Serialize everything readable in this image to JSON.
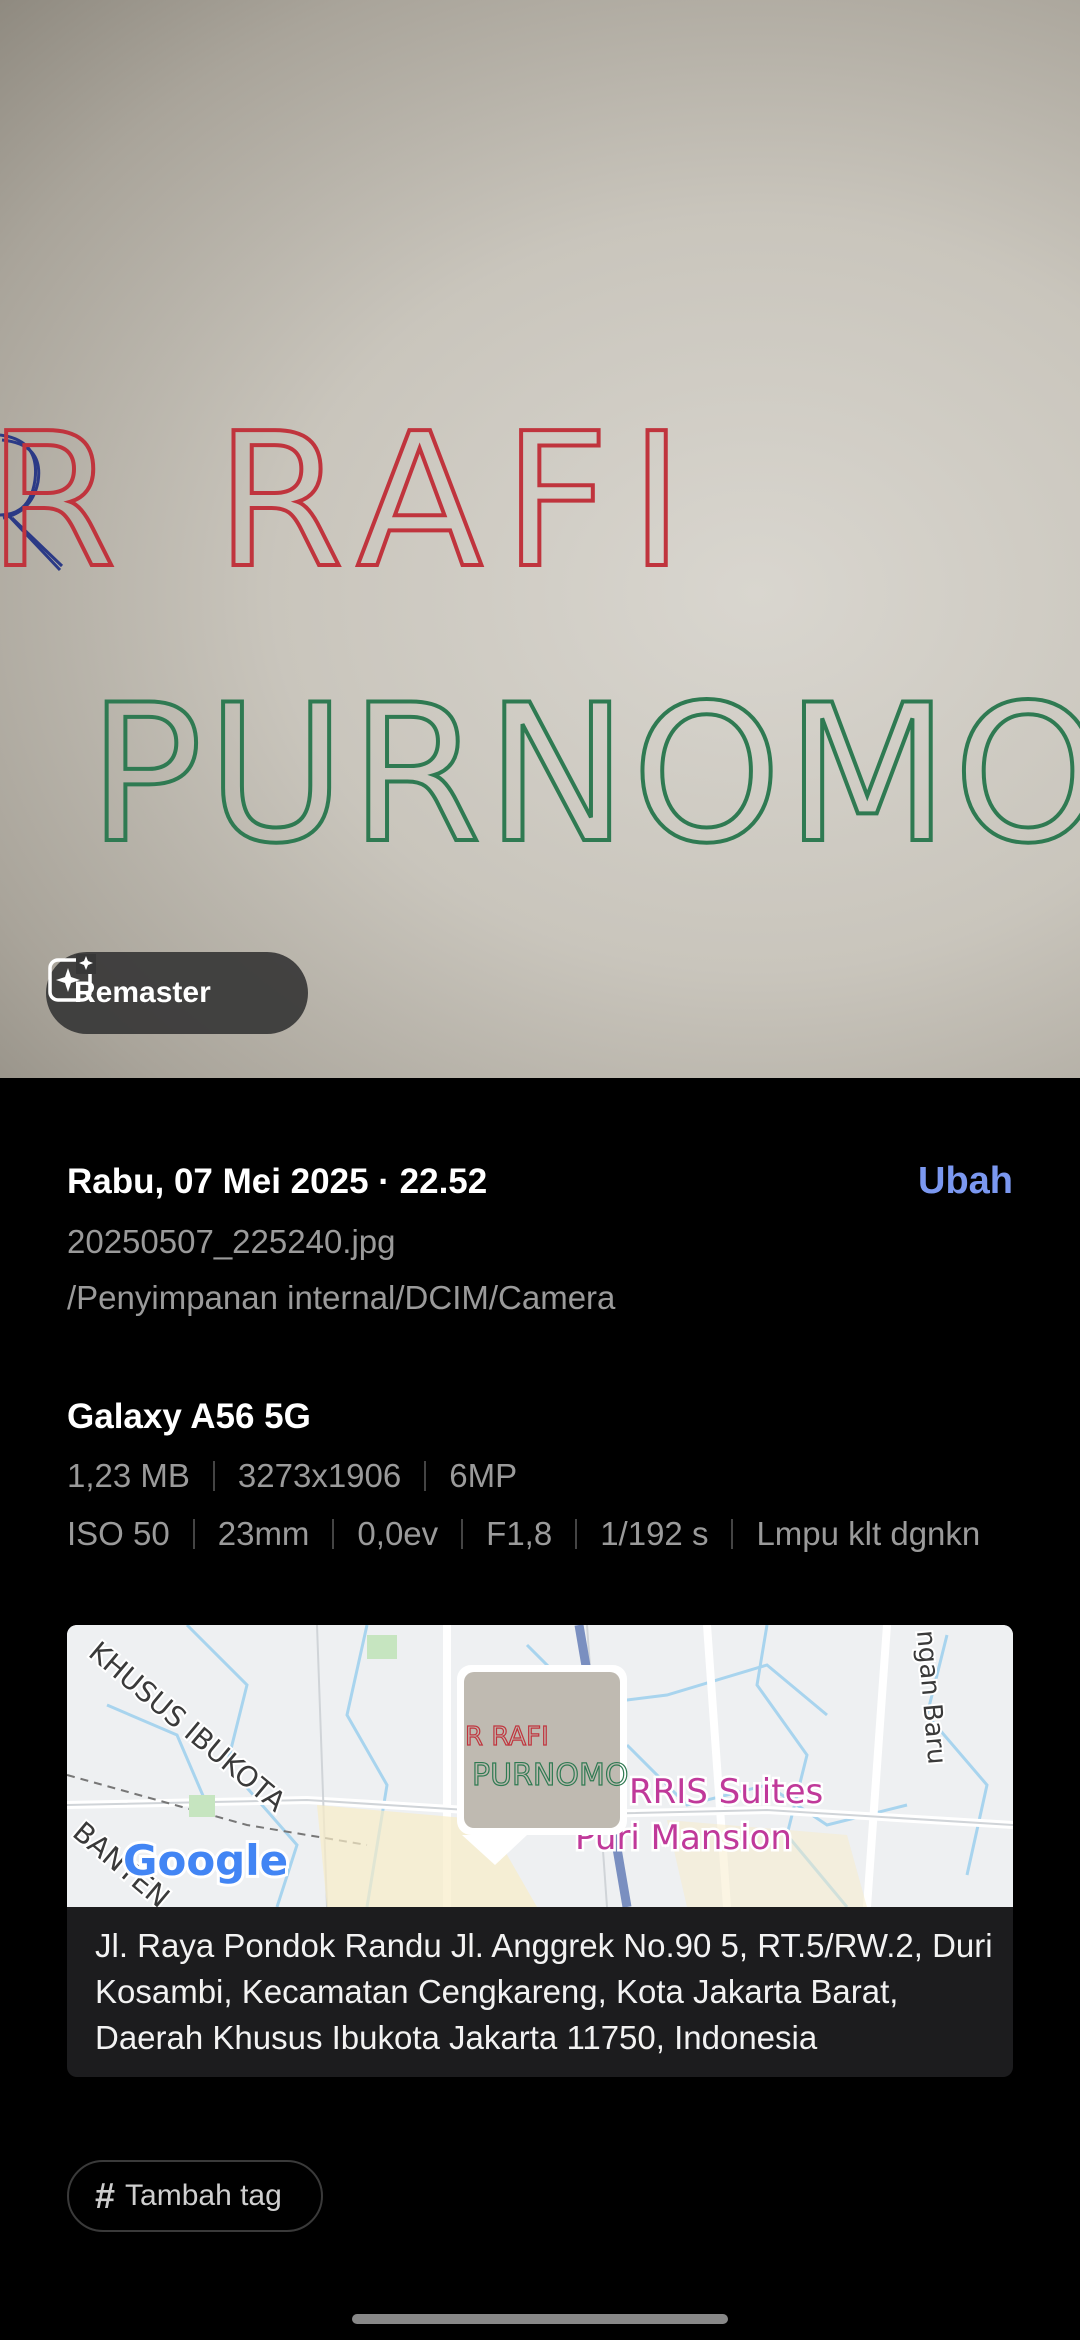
{
  "photo": {
    "line1": "R RAFI",
    "line2": "PURNOMO"
  },
  "remaster": {
    "label": "Remaster",
    "icon": "sparkle-edit-icon"
  },
  "details": {
    "date": "Rabu, 07 Mei 2025 · 22.52",
    "edit_label": "Ubah",
    "filename": "20250507_225240.jpg",
    "path": "/Penyimpanan internal/DCIM/Camera"
  },
  "device": {
    "name": "Galaxy A56 5G",
    "row1": [
      "1,23 MB",
      "3273x1906",
      "6MP"
    ],
    "row2": [
      "ISO 50",
      "23mm",
      "0,0ev",
      "F1,8",
      "1/192 s",
      "Lmpu klt dgnkn"
    ]
  },
  "map": {
    "poi_line1": "RRIS Suites",
    "poi_line2": "Puri Mansion",
    "road1": "KHUSUS IBUKOTA",
    "road2": "BANTEN",
    "road3": "ngan Baru",
    "google": "Google",
    "address": "Jl. Raya Pondok Randu Jl. Anggrek No.90 5, RT.5/RW.2, Duri Kosambi, Kecamatan Cengkareng, Kota Jakarta Barat, Daerah Khusus Ibukota Jakarta 11750, Indonesia"
  },
  "tag": {
    "label": "Tambah tag",
    "icon": "hash-icon"
  },
  "colors": {
    "accent": "#7b98f0",
    "background": "#000000",
    "secondary_text": "#9a9a9a",
    "poi": "#c0399a"
  }
}
